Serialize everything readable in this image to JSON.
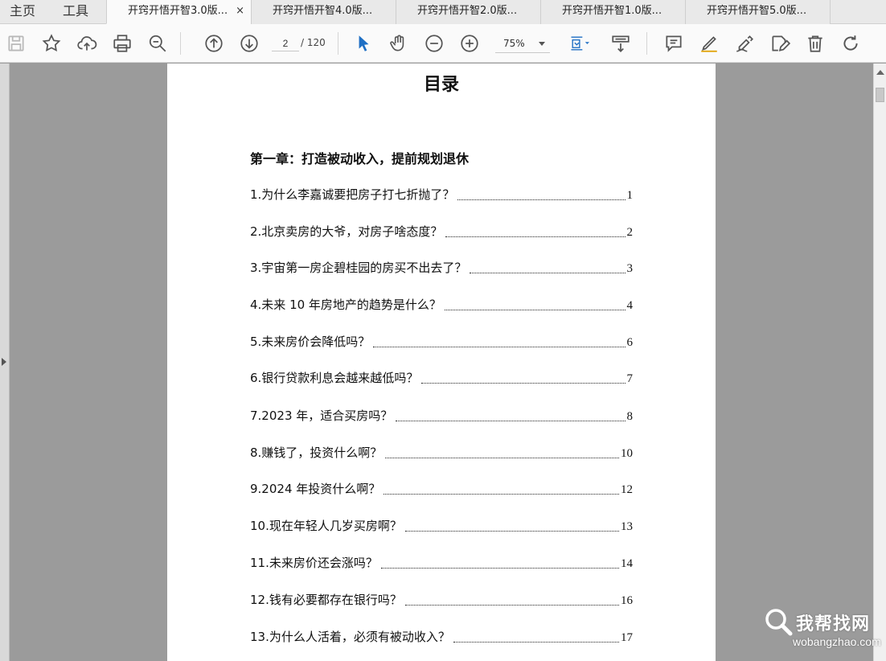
{
  "menu": {
    "home_label": "主页",
    "tools_label": "工具"
  },
  "tabs": [
    {
      "label": "开窍开悟开智3.0版...",
      "active": true
    },
    {
      "label": "开窍开悟开智4.0版..."
    },
    {
      "label": "开窍开悟开智2.0版..."
    },
    {
      "label": "开窍开悟开智1.0版..."
    },
    {
      "label": "开窍开悟开智5.0版..."
    }
  ],
  "tab_close_glyph": "×",
  "toolbar": {
    "icons": [
      "save-icon",
      "star-icon",
      "upload-cloud-icon",
      "print-icon",
      "zoom-search-icon",
      "prev-page-icon",
      "next-page-icon",
      "select-cursor-icon",
      "hand-icon",
      "zoom-out-icon",
      "zoom-in-icon",
      "fit-page-icon",
      "scroll-mode-icon",
      "comment-icon",
      "highlight-icon",
      "sign-icon",
      "edit-icon",
      "delete-icon",
      "rotate-icon"
    ],
    "accent_color": "#1f6fc4",
    "current_page": "2",
    "total_pages": "/ 120",
    "zoom": "75%"
  },
  "document": {
    "title": "目录",
    "chapter": "第一章：打造被动收入，提前规划退休",
    "entries": [
      {
        "title": "1.为什么李嘉诚要把房子打七折抛了？",
        "page": "1"
      },
      {
        "title": "2.北京卖房的大爷，对房子啥态度？",
        "page": "2"
      },
      {
        "title": "3.宇宙第一房企碧桂园的房买不出去了？",
        "page": "3"
      },
      {
        "title": "4.未来 10 年房地产的趋势是什么？",
        "page": "4"
      },
      {
        "title": "5.未来房价会降低吗？",
        "page": "6"
      },
      {
        "title": "6.银行贷款利息会越来越低吗？",
        "page": "7"
      },
      {
        "title": "7.2023 年，适合买房吗？",
        "page": "8"
      },
      {
        "title": "8.赚钱了，投资什么啊？",
        "page": "10"
      },
      {
        "title": "9.2024 年投资什么啊？",
        "page": "12"
      },
      {
        "title": "10.现在年轻人几岁买房啊？",
        "page": "13"
      },
      {
        "title": "11.未来房价还会涨吗？",
        "page": "14"
      },
      {
        "title": "12.钱有必要都存在银行吗？",
        "page": "16"
      },
      {
        "title": "13.为什么人活着，必须有被动收入？",
        "page": "17"
      }
    ]
  },
  "watermark": {
    "main": "我帮找网",
    "sub": "wobangzhao.com"
  }
}
